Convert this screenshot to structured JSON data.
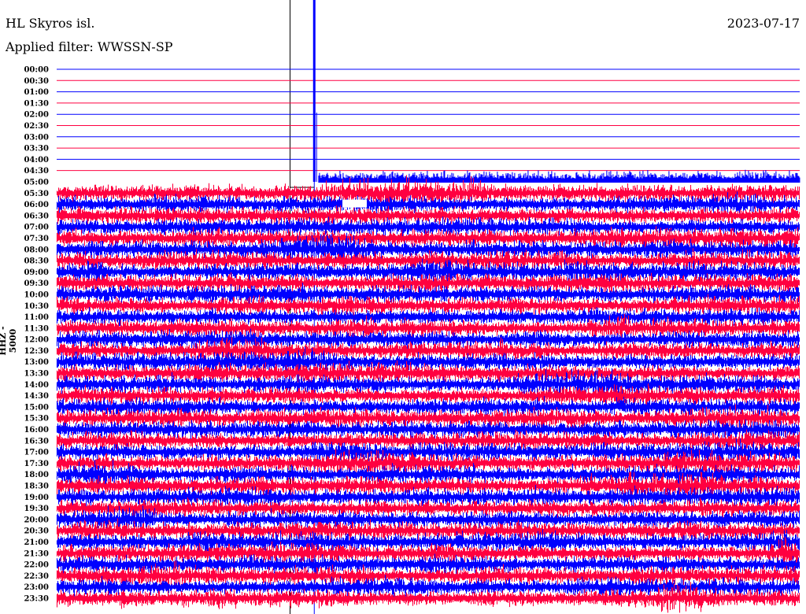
{
  "header": {
    "station": "HL Skyros isl.",
    "filter": "Applied filter: WWSSN-SP",
    "date": "2023-07-17"
  },
  "chart_data": {
    "type": "line",
    "title": "HL Skyros isl.",
    "subtitle": "Applied filter: WWSSN-SP",
    "date": "2023-07-17",
    "ylabel": "HHZ - 5000",
    "minutes_per_row": 30,
    "row_labels": [
      "00:00",
      "00:30",
      "01:00",
      "01:30",
      "02:00",
      "02:30",
      "03:00",
      "03:30",
      "04:00",
      "04:30",
      "05:00",
      "05:30",
      "06:00",
      "06:30",
      "07:00",
      "07:30",
      "08:00",
      "08:30",
      "09:00",
      "09:30",
      "10:00",
      "10:30",
      "11:00",
      "11:30",
      "12:00",
      "12:30",
      "13:00",
      "13:30",
      "14:00",
      "14:30",
      "15:00",
      "15:30",
      "16:00",
      "16:30",
      "17:00",
      "17:30",
      "18:00",
      "18:30",
      "19:00",
      "19:30",
      "20:00",
      "20:30",
      "21:00",
      "21:30",
      "22:00",
      "22:30",
      "23:00",
      "23:30"
    ],
    "series_colors": [
      "#0000ff",
      "#ff0040"
    ],
    "no_data_rows_until": "05:00",
    "data_start_offset_min": 10.5,
    "spike_offset_min": 10.4,
    "grid": false
  }
}
